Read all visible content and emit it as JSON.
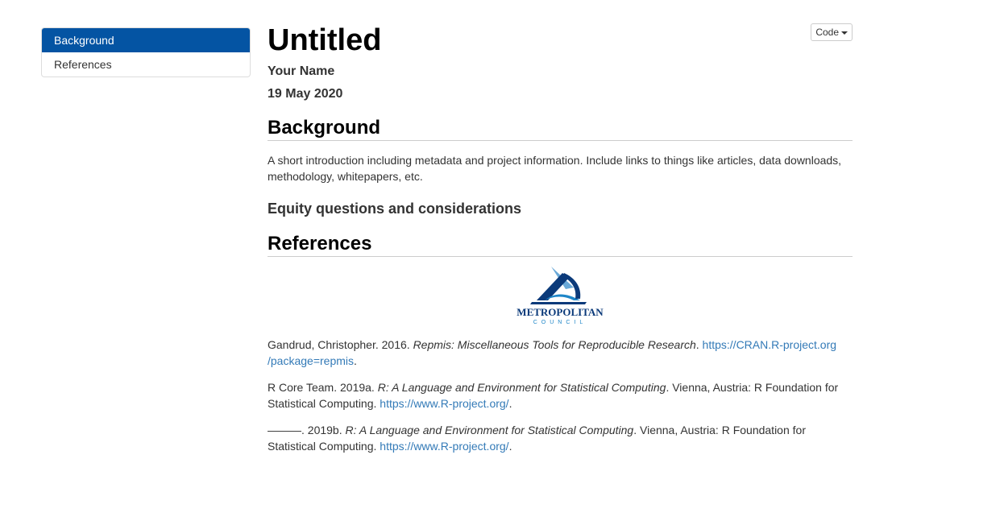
{
  "toc": {
    "items": [
      {
        "label": "Background",
        "active": true
      },
      {
        "label": "References",
        "active": false
      }
    ]
  },
  "header": {
    "title": "Untitled",
    "author": "Your Name",
    "date": "19 May 2020",
    "code_button": "Code"
  },
  "background": {
    "heading": "Background",
    "text": "A short introduction including metadata and project information. Include links to things like articles, data downloads, methodology, whitepapers, etc.",
    "subheading": "Equity questions and considerations"
  },
  "references": {
    "heading": "References",
    "logo": {
      "line1": "METROPOLITAN",
      "line2": "COUNCIL"
    },
    "entries": [
      {
        "prefix": "Gandrud, Christopher. 2016. ",
        "title": "Repmis: Miscellaneous Tools for Reproducible Research",
        "middle": ". ",
        "link": "https://CRAN.R-project.org/package=repmis",
        "suffix": "."
      },
      {
        "prefix": "R Core Team. 2019a. ",
        "title": "R: A Language and Environment for Statistical Computing",
        "middle": ". Vienna, Austria: R Foundation for Statistical Computing. ",
        "link": "https://www.R-project.org/",
        "suffix": "."
      },
      {
        "prefix": "———. 2019b. ",
        "title": "R: A Language and Environment for Statistical Computing",
        "middle": ". Vienna, Austria: R Foundation for Statistical Computing. ",
        "link": "https://www.R-project.org/",
        "suffix": "."
      }
    ]
  },
  "colors": {
    "toc_active": "#0454a3",
    "link": "#337ab7",
    "logo_dark": "#0b3a7a",
    "logo_light": "#1e86c8"
  }
}
